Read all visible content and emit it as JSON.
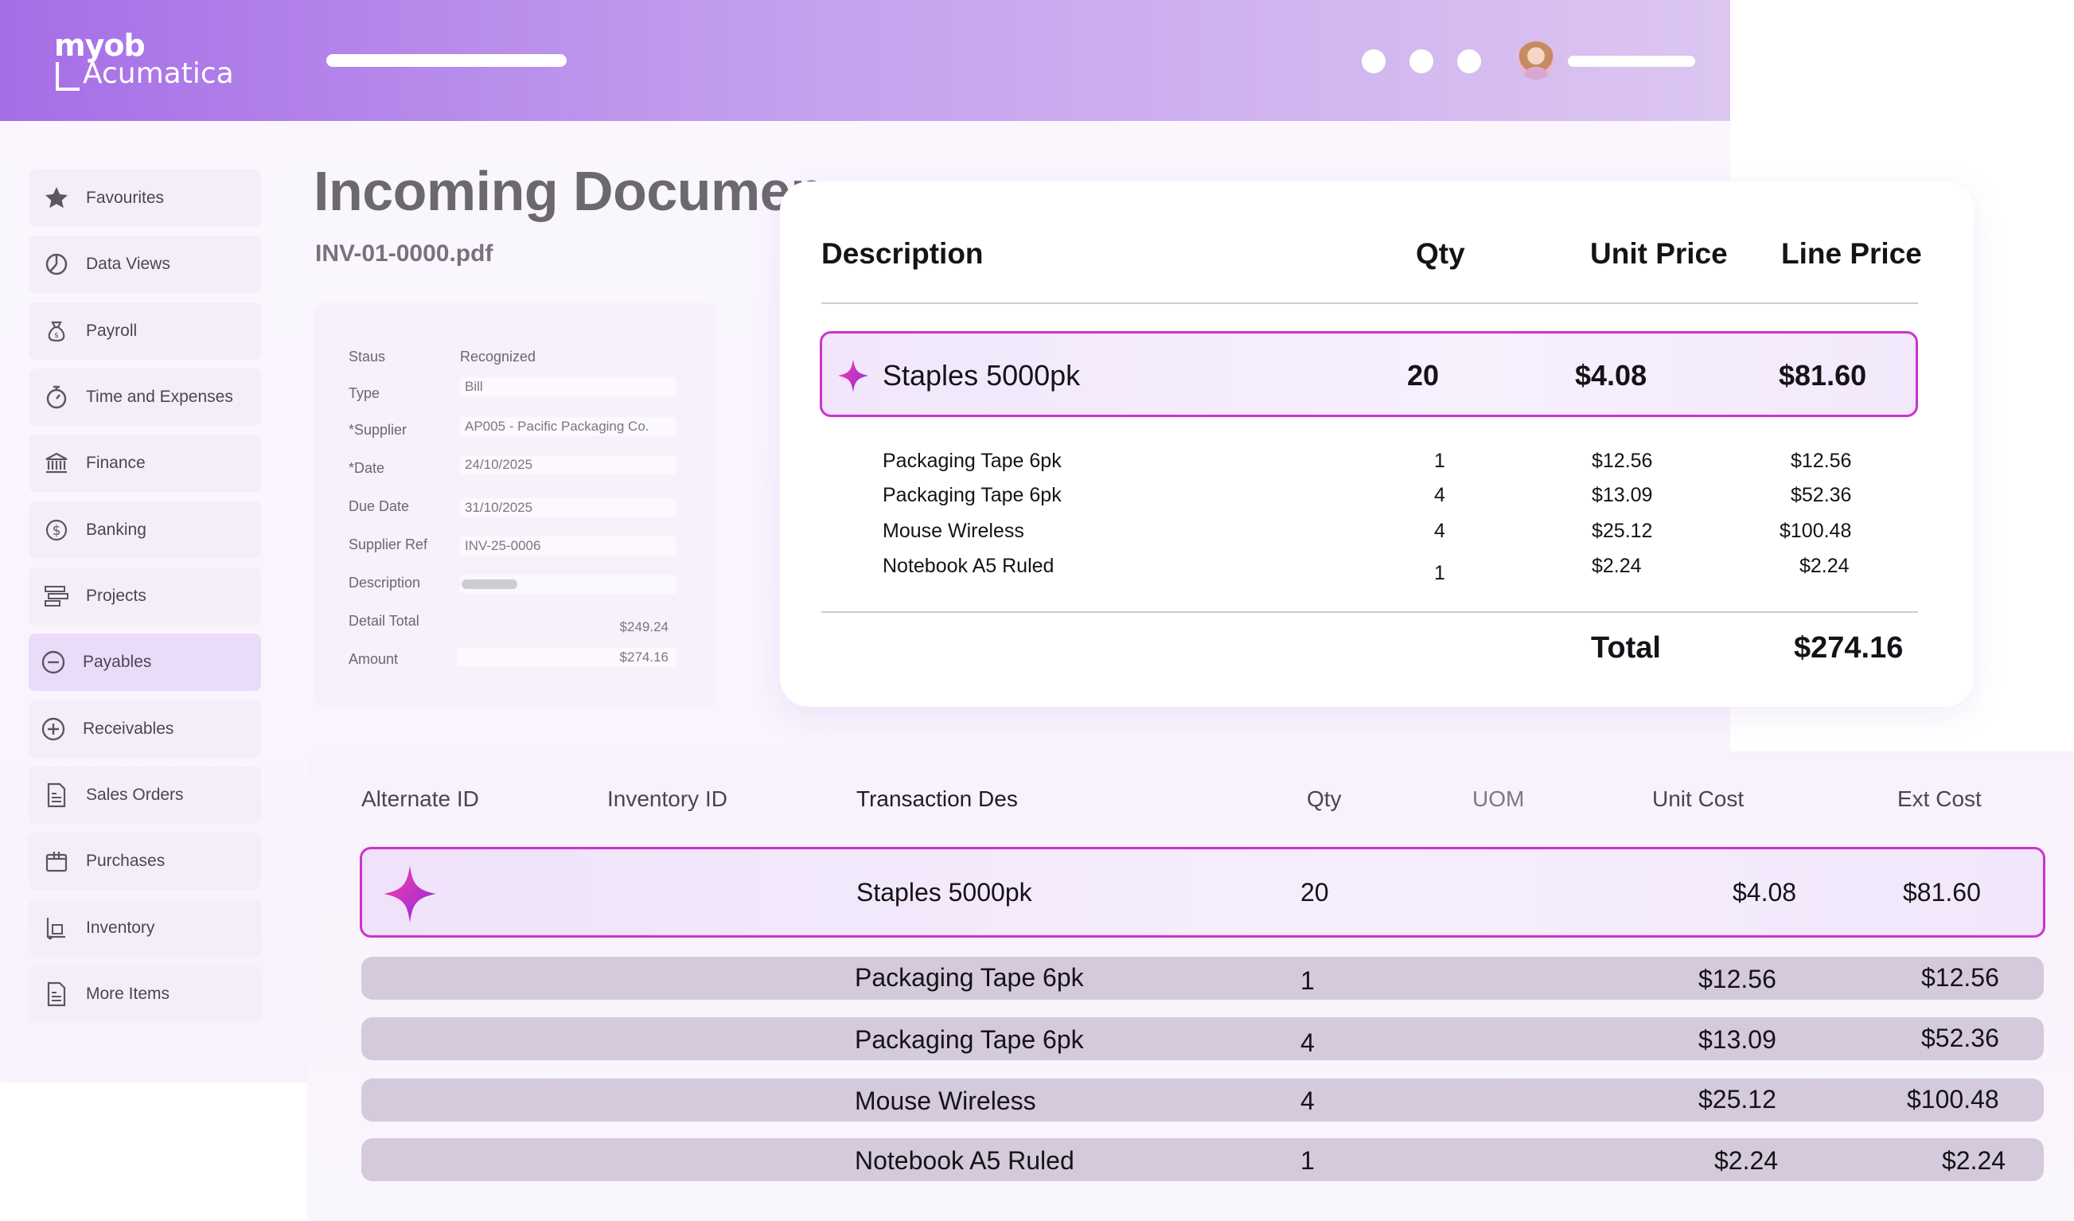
{
  "brand": {
    "line1": "myob",
    "line2": "Acumatica"
  },
  "sidebar": {
    "items": [
      {
        "label": "Favourites",
        "icon": "star-icon"
      },
      {
        "label": "Data Views",
        "icon": "pie-chart-icon"
      },
      {
        "label": "Payroll",
        "icon": "money-bag-icon"
      },
      {
        "label": "Time and Expenses",
        "icon": "stopwatch-icon"
      },
      {
        "label": "Finance",
        "icon": "bank-icon"
      },
      {
        "label": "Banking",
        "icon": "dollar-circle-icon"
      },
      {
        "label": "Projects",
        "icon": "projects-icon"
      },
      {
        "label": "Payables",
        "icon": "minus-circle-icon"
      },
      {
        "label": "Receivables",
        "icon": "plus-circle-icon"
      },
      {
        "label": "Sales Orders",
        "icon": "document-icon"
      },
      {
        "label": "Purchases",
        "icon": "box-icon"
      },
      {
        "label": "Inventory",
        "icon": "dolly-icon"
      },
      {
        "label": "More Items",
        "icon": "document-icon"
      }
    ],
    "active": "Payables"
  },
  "document": {
    "title": "Incoming Documen",
    "file": "INV-01-0000.pdf"
  },
  "form": {
    "status_label": "Staus",
    "status_value": "Recognized",
    "type_label": "Type",
    "type_value": "Bill",
    "supplier_label": "*Supplier",
    "supplier_value": "AP005 - Pacific Packaging Co.",
    "date_label": "*Date",
    "date_value": "24/10/2025",
    "due_label": "Due Date",
    "due_value": "31/10/2025",
    "ref_label": "Supplier Ref",
    "ref_value": "INV-25-0006",
    "desc_label": "Description",
    "detail_total_label": "Detail Total",
    "detail_total_value": "$249.24",
    "amount_label": "Amount",
    "amount_value": "$274.16"
  },
  "invoice": {
    "headers": {
      "description": "Description",
      "qty": "Qty",
      "unit_price": "Unit Price",
      "line_price": "Line Price"
    },
    "highlight": {
      "description": "Staples 5000pk",
      "qty": "20",
      "unit_price": "$4.08",
      "line_price": "$81.60"
    },
    "rows": [
      {
        "description": "Packaging Tape 6pk",
        "qty": "1",
        "unit_price": "$12.56",
        "line_price": "$12.56"
      },
      {
        "description": "Packaging Tape 6pk",
        "qty": "4",
        "unit_price": "$13.09",
        "line_price": "$52.36"
      },
      {
        "description": "Mouse Wireless",
        "qty": "4",
        "unit_price": "$25.12",
        "line_price": "$100.48"
      },
      {
        "description": "Notebook A5 Ruled",
        "qty": "1",
        "unit_price": "$2.24",
        "line_price": "$2.24"
      }
    ],
    "total_label": "Total",
    "total_value": "$274.16"
  },
  "grid": {
    "headers": {
      "alt_id": "Alternate ID",
      "inv_id": "Inventory ID",
      "trans_desc": "Transaction Des",
      "qty": "Qty",
      "uom": "UOM",
      "unit_cost": "Unit Cost",
      "ext_cost": "Ext Cost"
    },
    "highlight": {
      "trans_desc": "Staples 5000pk",
      "qty": "20",
      "unit_cost": "$4.08",
      "ext_cost": "$81.60"
    },
    "rows": [
      {
        "trans_desc": "Packaging Tape 6pk",
        "qty": "1",
        "unit_cost": "$12.56",
        "ext_cost": "$12.56"
      },
      {
        "trans_desc": "Packaging Tape 6pk",
        "qty": "4",
        "unit_cost": "$13.09",
        "ext_cost": "$52.36"
      },
      {
        "trans_desc": "Mouse Wireless",
        "qty": "4",
        "unit_cost": "$25.12",
        "ext_cost": "$100.48"
      },
      {
        "trans_desc": "Notebook A5 Ruled",
        "qty": "1",
        "unit_cost": "$2.24",
        "ext_cost": "$2.24"
      }
    ]
  },
  "colors": {
    "accent": "#cc33cc",
    "topbar_start": "#a66ee6",
    "topbar_end": "#dcc6f1",
    "sparkle_start": "#ff3fa0",
    "sparkle_end": "#8a2be2"
  }
}
